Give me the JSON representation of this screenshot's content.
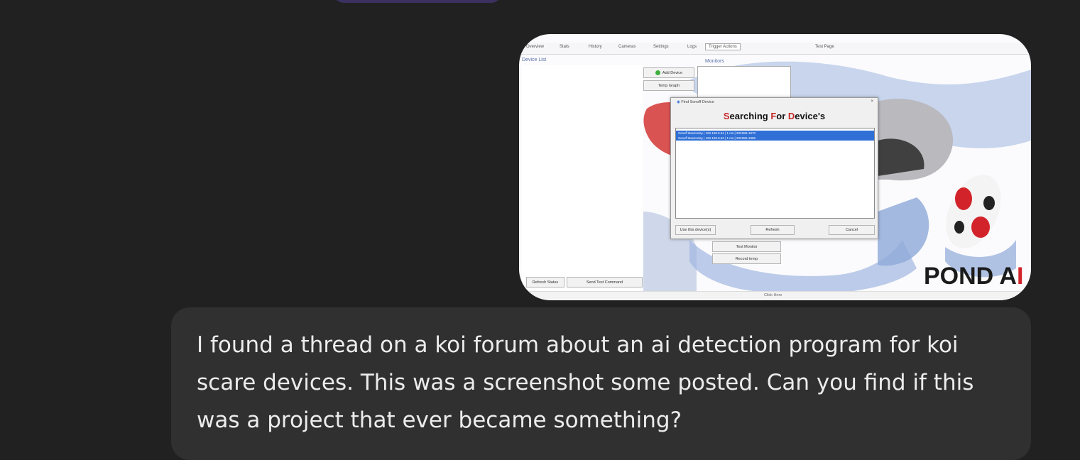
{
  "attachment": {
    "tabs": [
      "Overview",
      "Stats",
      "History",
      "Cameras",
      "Settings",
      "Logs",
      "Trigger Actions",
      "Test Page"
    ],
    "active_tab": "Trigger Actions",
    "labels": {
      "device_list": "Device List",
      "monitors": "Monitors"
    },
    "buttons": {
      "add_device": "Add Device",
      "temp_graph": "Temp Graph",
      "test_monitor": "Test Monitor",
      "record_temp": "Record temp",
      "refresh_status": "Refresh Status",
      "send_test_command": "Send Test Command"
    },
    "footer_text": "Click Here",
    "dialog": {
      "title": "Find Sonoff Device",
      "close_glyph": "×",
      "heading_parts": [
        "S",
        "earching ",
        "F",
        "or ",
        "D",
        "evice's"
      ],
      "rows": [
        "Sonoff Basicrelay | 192.168.0.61 | 1 ms | 2021B6-1970",
        "Sonoff Basicrelay | 192.168.0.62 | 1 ms | 2021B6-1986"
      ],
      "buttons": {
        "use": "Use this device(s)",
        "refresh": "Refresh",
        "cancel": "Cancel"
      }
    },
    "logo": {
      "part1": "POND A",
      "part2": "I"
    }
  },
  "message": {
    "text": "I found a thread on a koi forum about an ai detection program for koi scare devices.  This was a screenshot some posted.  Can you find if this was a project that ever became something?"
  },
  "colors": {
    "background": "#212121",
    "bubble": "#303030",
    "text": "#ececec",
    "pill": "#3b3161"
  }
}
